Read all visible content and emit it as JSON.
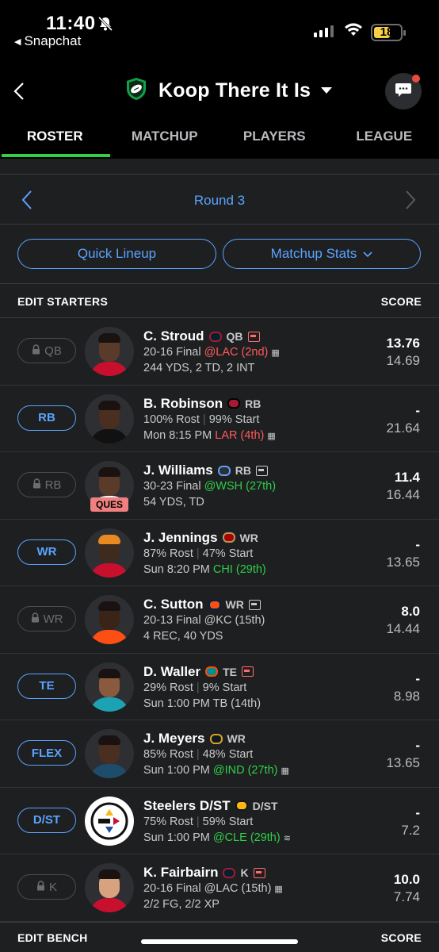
{
  "status": {
    "time": "11:40",
    "back_app": "Snapchat",
    "battery": "18"
  },
  "header": {
    "league_name": "Koop There It Is"
  },
  "tabs": [
    "ROSTER",
    "MATCHUP",
    "PLAYERS",
    "LEAGUE"
  ],
  "round": {
    "label": "Round 3"
  },
  "buttons": {
    "quick_lineup": "Quick Lineup",
    "matchup_stats": "Matchup Stats"
  },
  "sections": {
    "starters": "EDIT STARTERS",
    "bench": "EDIT BENCH",
    "score": "SCORE"
  },
  "players": [
    {
      "slot": "QB",
      "locked": true,
      "name": "C. Stroud",
      "pos": "QB",
      "line2": "20-16 Final",
      "opp": "@LAC (2nd)",
      "opp_color": "red",
      "line3": "244 YDS, 2 TD, 2 INT",
      "score": "13.76",
      "proj": "14.69"
    },
    {
      "slot": "RB",
      "locked": false,
      "name": "B. Robinson",
      "pos": "RB",
      "rost": "100% Rost",
      "start": "99% Start",
      "line3_time": "Mon 8:15 PM",
      "opp3": "LAR (4th)",
      "opp_color": "red",
      "score": "-",
      "proj": "21.64"
    },
    {
      "slot": "RB",
      "locked": true,
      "name": "J. Williams",
      "pos": "RB",
      "status": "QUES",
      "line2": "30-23 Final",
      "opp": "@WSH (27th)",
      "opp_color": "green",
      "line3": "54 YDS, TD",
      "score": "11.4",
      "proj": "16.44"
    },
    {
      "slot": "WR",
      "locked": false,
      "name": "J. Jennings",
      "pos": "WR",
      "rost": "87% Rost",
      "start": "47% Start",
      "line3_time": "Sun 8:20 PM",
      "opp3": "CHI (29th)",
      "opp_color": "green",
      "score": "-",
      "proj": "13.65"
    },
    {
      "slot": "WR",
      "locked": true,
      "name": "C. Sutton",
      "pos": "WR",
      "line2": "20-13 Final",
      "opp": "@KC (15th)",
      "opp_color": "gray",
      "line3": "4 REC, 40 YDS",
      "score": "8.0",
      "proj": "14.44"
    },
    {
      "slot": "TE",
      "locked": false,
      "name": "D. Waller",
      "pos": "TE",
      "rost": "29% Rost",
      "start": "9% Start",
      "line3_time": "Sun 1:00 PM",
      "opp3": "TB (14th)",
      "opp_color": "gray",
      "score": "-",
      "proj": "8.98"
    },
    {
      "slot": "FLEX",
      "locked": false,
      "name": "J. Meyers",
      "pos": "WR",
      "rost": "85% Rost",
      "start": "48% Start",
      "line3_time": "Sun 1:00 PM",
      "opp3": "@IND (27th)",
      "opp_color": "green",
      "score": "-",
      "proj": "13.65"
    },
    {
      "slot": "D/ST",
      "locked": false,
      "name": "Steelers D/ST",
      "pos": "D/ST",
      "rost": "75% Rost",
      "start": "59% Start",
      "line3_time": "Sun 1:00 PM",
      "opp3": "@CLE (29th)",
      "opp_color": "green",
      "score": "-",
      "proj": "7.2"
    },
    {
      "slot": "K",
      "locked": true,
      "name": "K. Fairbairn",
      "pos": "K",
      "line2": "20-16 Final",
      "opp": "@LAC (15th)",
      "opp_color": "gray",
      "line3": "2/2 FG, 2/2 XP",
      "score": "10.0",
      "proj": "7.74"
    }
  ],
  "colors": {
    "accent": "#5aa3ff",
    "active_tab": "#2fcf47",
    "bad_matchup": "#ff5a5a",
    "good_matchup": "#2fcf47"
  }
}
